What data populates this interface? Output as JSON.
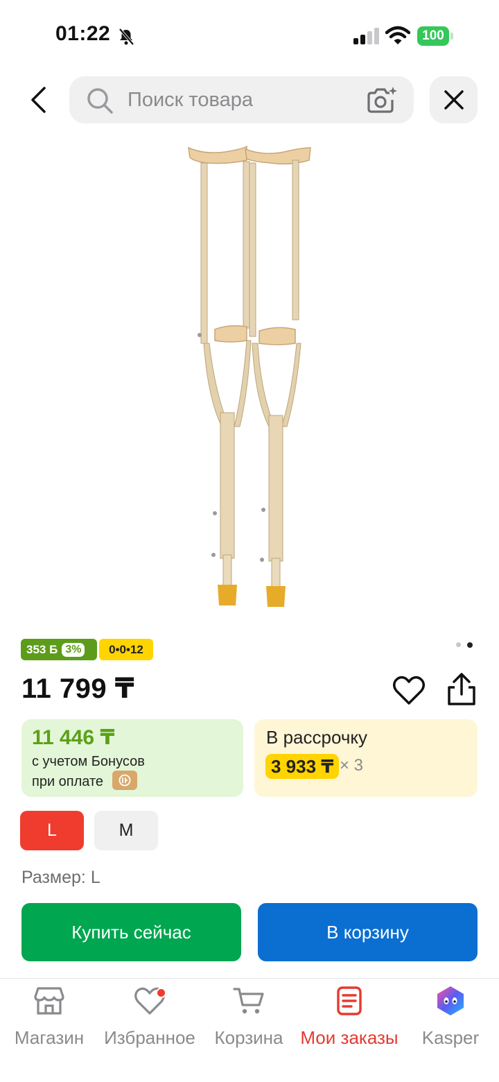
{
  "status_bar": {
    "time": "01:22",
    "battery": "100"
  },
  "header": {
    "search_placeholder": "Поиск товара"
  },
  "badges": {
    "bonus": "353 Б",
    "bonus_percent": "3%",
    "installment": "0•0•12"
  },
  "product": {
    "price": "11 799 ₸"
  },
  "bonus_card": {
    "price": "11 446 ₸",
    "line1": "с учетом Бонусов",
    "line2": "при оплате"
  },
  "installment_card": {
    "title": "В рассрочку",
    "amount": "3 933 ₸",
    "multiplier": "× 3"
  },
  "sizes": {
    "options": [
      "L",
      "M"
    ],
    "selected_label": "Размер: L"
  },
  "actions": {
    "buy_now": "Купить сейчас",
    "add_to_cart": "В корзину"
  },
  "tabbar": {
    "items": [
      {
        "label": "Магазин",
        "icon": "store-icon"
      },
      {
        "label": "Избранное",
        "icon": "heart-icon"
      },
      {
        "label": "Корзина",
        "icon": "cart-icon"
      },
      {
        "label": "Мои заказы",
        "icon": "orders-icon"
      },
      {
        "label": "Kasper",
        "icon": "kasper-icon"
      }
    ]
  },
  "colors": {
    "accent_red": "#f03b2f",
    "buy_green": "#00a650",
    "cart_blue": "#0a6fd0",
    "bonus_green": "#5ba117",
    "installment_yellow": "#ffd400"
  }
}
